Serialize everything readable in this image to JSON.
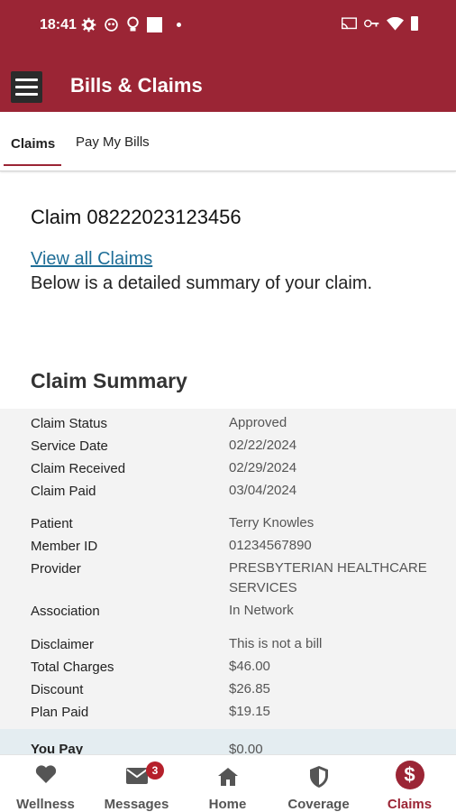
{
  "status_bar": {
    "time": "18:41"
  },
  "header": {
    "title": "Bills & Claims"
  },
  "tabs": [
    {
      "label": "Claims",
      "active": true
    },
    {
      "label": "Pay My Bills",
      "active": false
    }
  ],
  "claim": {
    "title": "Claim 08222023123456",
    "view_all_link": "View all Claims",
    "subtitle": "Below is a detailed summary of your claim."
  },
  "summary": {
    "title": "Claim Summary",
    "rows": [
      {
        "label": "Claim Status",
        "value": "Approved"
      },
      {
        "label": "Service Date",
        "value": "02/22/2024"
      },
      {
        "label": "Claim Received",
        "value": "02/29/2024"
      },
      {
        "label": "Claim Paid",
        "value": "03/04/2024"
      },
      {
        "label": "Patient",
        "value": "Terry Knowles"
      },
      {
        "label": "Member ID",
        "value": "01234567890"
      },
      {
        "label": "Provider",
        "value": "PRESBYTERIAN HEALTHCARE SERVICES"
      },
      {
        "label": "Association",
        "value": "In Network"
      },
      {
        "label": "Disclaimer",
        "value": "This is not a bill"
      },
      {
        "label": "Total Charges",
        "value": "$46.00"
      },
      {
        "label": "Discount",
        "value": "$26.85"
      },
      {
        "label": "Plan Paid",
        "value": "$19.15"
      }
    ],
    "you_pay": {
      "label": "You Pay",
      "value": "$0.00"
    }
  },
  "bottom_nav": {
    "items": [
      {
        "label": "Wellness",
        "icon": "heart-icon"
      },
      {
        "label": "Messages",
        "icon": "mail-icon",
        "badge": "3"
      },
      {
        "label": "Home",
        "icon": "home-icon"
      },
      {
        "label": "Coverage",
        "icon": "shield-icon"
      },
      {
        "label": "Claims",
        "icon": "dollar-icon",
        "active": true
      }
    ]
  },
  "colors": {
    "brand": "#9b2535",
    "link": "#1f6e97",
    "badge": "#b5202b"
  }
}
